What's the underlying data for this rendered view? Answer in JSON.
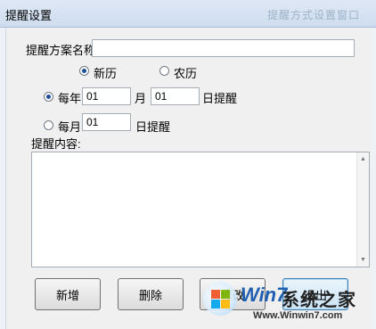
{
  "window": {
    "title": "提醒设置",
    "ghost_title": "提醒方式设置窗口"
  },
  "form": {
    "scheme_label": "提醒方案名称:",
    "scheme_value": "",
    "calendar": {
      "solar_label": "新历",
      "lunar_label": "农历",
      "selected": "solar"
    },
    "yearly": {
      "label": "每年",
      "month_value": "01",
      "month_unit": "月",
      "day_value": "01",
      "day_unit": "日提醒",
      "selected": true
    },
    "monthly": {
      "label": "每月",
      "day_value": "01",
      "day_unit": "日提醒",
      "selected": false
    },
    "content_label": "提醒内容:",
    "content_value": ""
  },
  "buttons": {
    "add": "新增",
    "delete": "删除",
    "modify": "修改",
    "exit": "退出"
  },
  "watermark": {
    "brand": "Win7",
    "name": "系统之家",
    "url": "Www.Winwin7.com"
  }
}
